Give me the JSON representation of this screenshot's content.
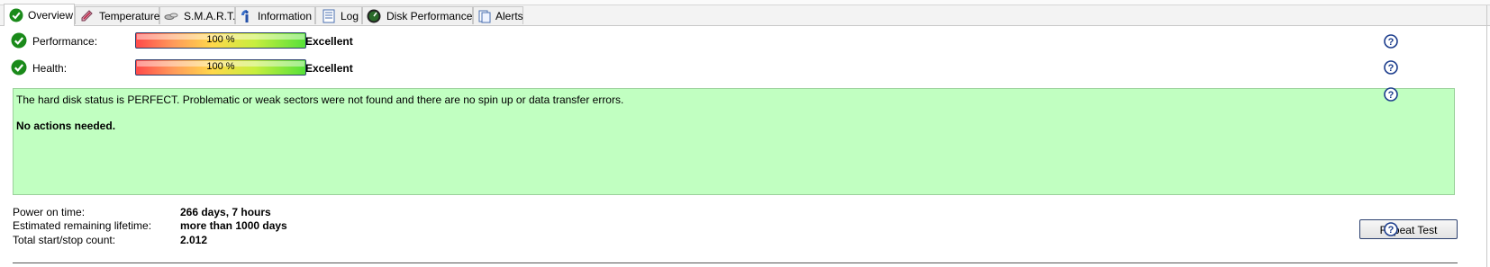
{
  "tabs": [
    {
      "label": "Overview",
      "icon": "check-circle-icon",
      "active": true
    },
    {
      "label": "Temperature",
      "icon": "thermometer-icon",
      "active": false
    },
    {
      "label": "S.M.A.R.T.",
      "icon": "smart-icon",
      "active": false
    },
    {
      "label": "Information",
      "icon": "info-icon",
      "active": false
    },
    {
      "label": "Log",
      "icon": "log-icon",
      "active": false
    },
    {
      "label": "Disk Performance",
      "icon": "gauge-icon",
      "active": false
    },
    {
      "label": "Alerts",
      "icon": "alerts-icon",
      "active": false
    }
  ],
  "performance": {
    "label": "Performance:",
    "percent_text": "100 %",
    "percent": 100,
    "rating": "Excellent"
  },
  "health": {
    "label": "Health:",
    "percent_text": "100 %",
    "percent": 100,
    "rating": "Excellent"
  },
  "status": {
    "message": "The hard disk status is PERFECT. Problematic or weak sectors were not found and there are no spin up or data transfer errors.",
    "action": "No actions needed.",
    "background_color": "#c1ffc1"
  },
  "info": {
    "power_on_label": "Power on time:",
    "power_on_value": "266 days, 7 hours",
    "lifetime_label": "Estimated remaining lifetime:",
    "lifetime_value": "more than 1000 days",
    "startstop_label": "Total start/stop count:",
    "startstop_value": "2.012"
  },
  "buttons": {
    "repeat_test": "Repeat Test"
  },
  "colors": {
    "check_green": "#1a8a1a",
    "help_blue": "#1b3c8c"
  }
}
